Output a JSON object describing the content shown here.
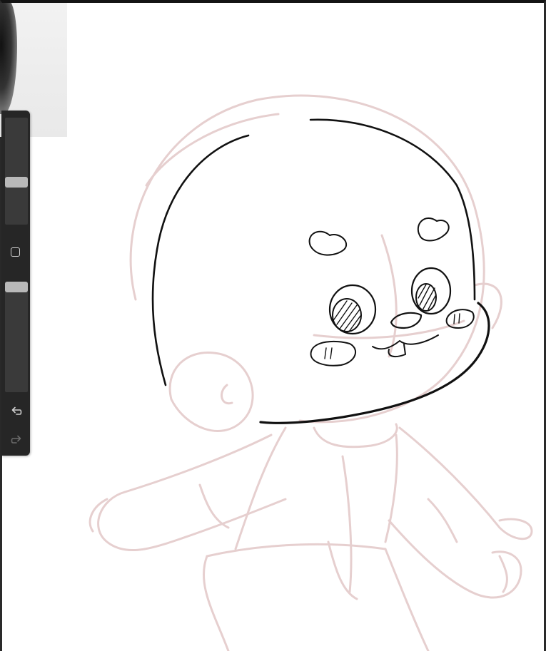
{
  "app": {
    "name": "drawing canvas"
  },
  "sidebar": {
    "brush_size_level": 0.65,
    "brush_opacity_level": 0.97,
    "modify_button_icon": "square-icon",
    "undo_icon": "undo-arrow-icon",
    "redo_icon": "redo-arrow-icon",
    "redo_enabled": false
  },
  "reference_window": {
    "visible": true
  },
  "colors": {
    "sidebar_bg": "#262626",
    "sketch_layer": "#e8d2d2",
    "ink_layer": "#111111",
    "canvas": "#ffffff"
  }
}
